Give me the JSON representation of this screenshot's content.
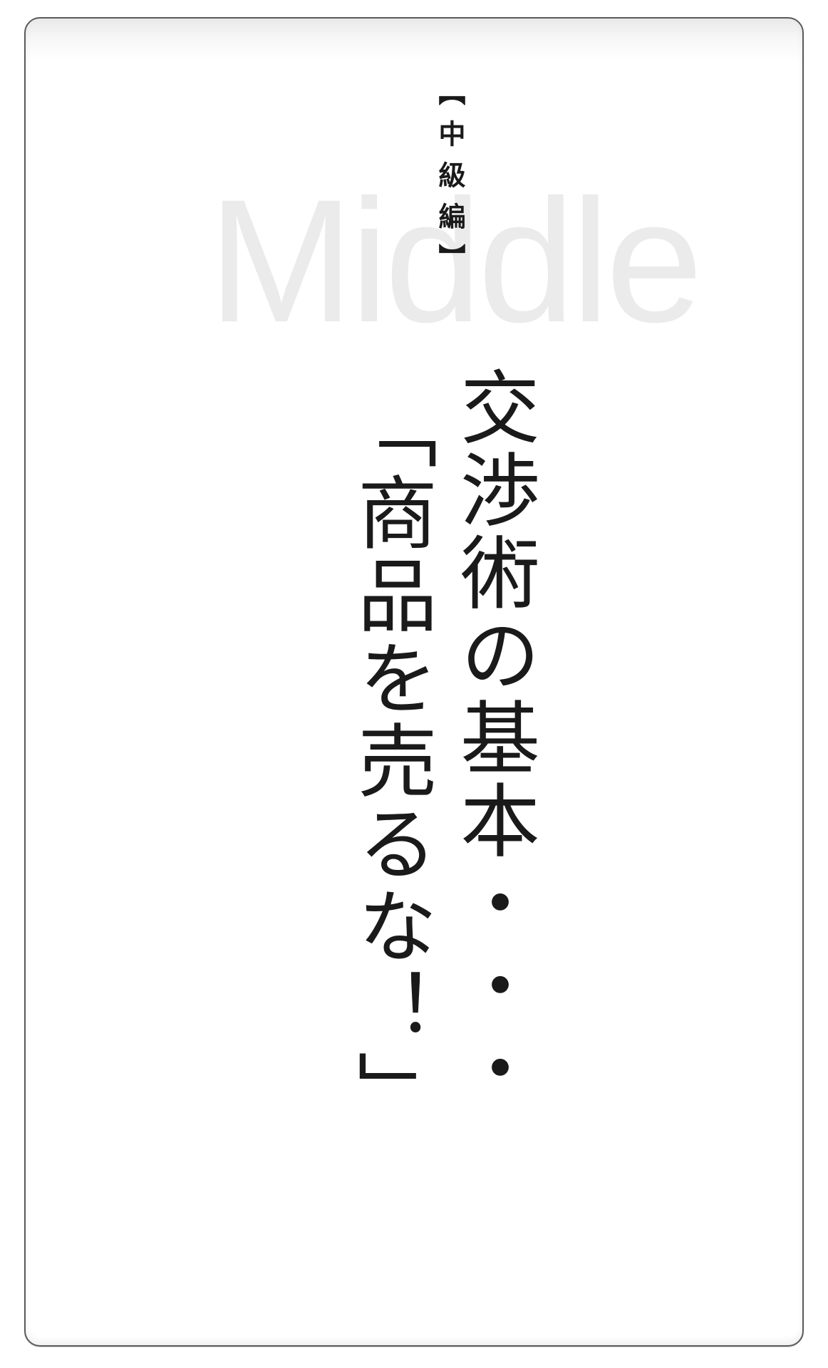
{
  "watermark": "Middle",
  "level_label": "【中級編】",
  "title": {
    "line1": "交渉術の基本・・・",
    "line2": "「商品を売るな！」"
  }
}
